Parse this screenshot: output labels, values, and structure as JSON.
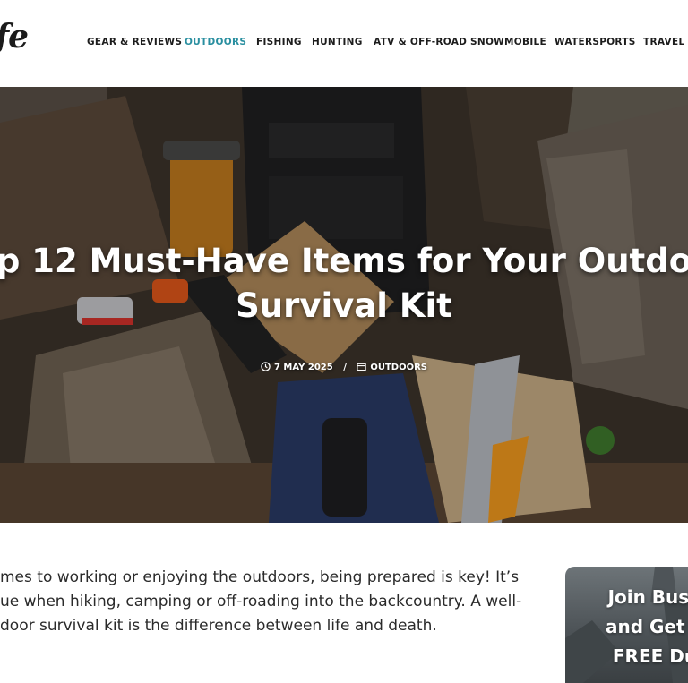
{
  "header": {
    "logo_text": "ife",
    "nav": [
      {
        "label": "GEAR & REVIEWS",
        "active": false
      },
      {
        "label": "OUTDOORS",
        "active": true
      },
      {
        "label": "FISHING",
        "active": false
      },
      {
        "label": "HUNTING",
        "active": false
      },
      {
        "label": "ATV & OFF-ROAD",
        "active": false
      },
      {
        "label": "SNOWMOBILE",
        "active": false
      },
      {
        "label": "WATERSPORTS",
        "active": false
      },
      {
        "label": "TRAVEL",
        "active": false
      }
    ],
    "accent_color": "#2a8fa0"
  },
  "hero": {
    "title_line1": "p 12 Must-Have Items for Your Outdo",
    "title_line2": "Survival Kit",
    "date": "7 MAY 2025",
    "separator": "/",
    "category": "OUTDOORS",
    "date_icon": "clock-icon",
    "category_icon": "folder-icon"
  },
  "article": {
    "intro_lines": [
      "mes to working or enjoying the outdoors, being prepared is key! It’s",
      "ue when hiking, camping or off-roading into the backcountry. A well-",
      "door survival kit is the difference between life and death."
    ]
  },
  "promo": {
    "line1": "Join Bush",
    "line2": "and Get Y",
    "line3": "FREE Du"
  }
}
